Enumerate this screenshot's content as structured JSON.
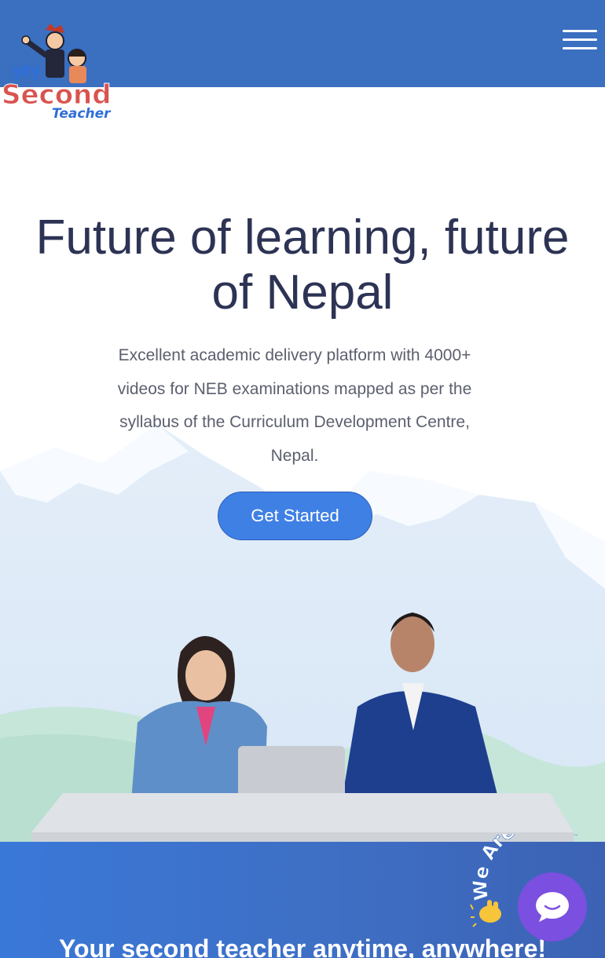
{
  "header": {
    "logo": {
      "line1": "My",
      "line2": "Second",
      "line3": "Teacher"
    },
    "menu_icon": "hamburger-icon"
  },
  "hero": {
    "title": "Future of learning, future of Nepal",
    "subtitle": "Excellent academic delivery platform with 4000+ videos for NEB examinations mapped as per the syllabus of the Curriculum Development Centre, Nepal.",
    "cta_label": "Get Started"
  },
  "section": {
    "title": "Your second teacher anytime, anywhere!"
  },
  "chat_widget": {
    "badge_text": "We Are Here!",
    "wave_icon": "waving-hand-icon",
    "button_icon": "chat-bubble-icon"
  },
  "colors": {
    "header_bg": "#3b6fc0",
    "title": "#2d3354",
    "cta_bg": "#3f80e4",
    "chat_button": "#7b4fe0"
  }
}
